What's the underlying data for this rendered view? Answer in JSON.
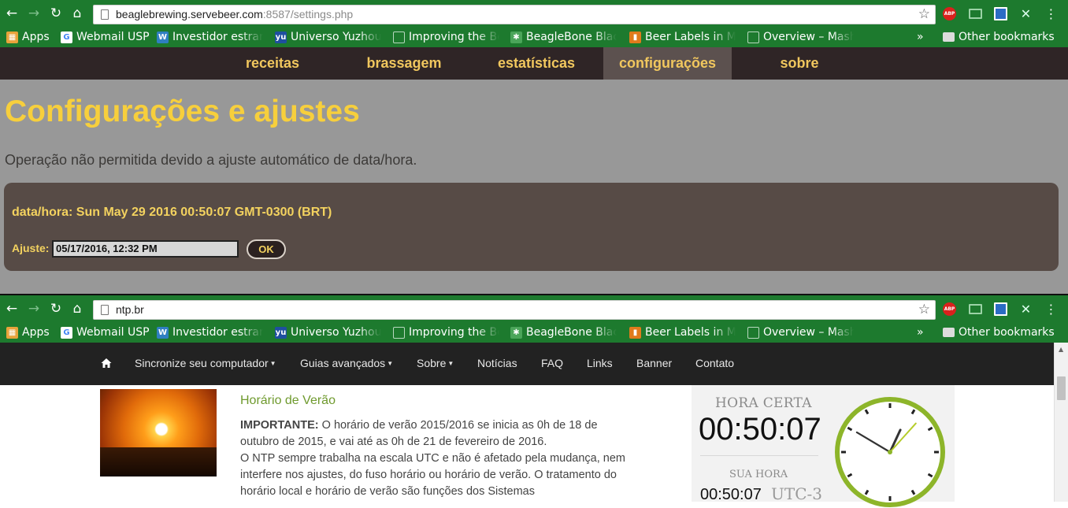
{
  "browser_top": {
    "url_host": "beaglebrewing.servebeer.com",
    "url_rest": ":8587/settings.php",
    "nav": {
      "back": "←",
      "forward": "→",
      "reload": "↻",
      "home": "⌂",
      "star": "☆"
    },
    "extensions": {
      "abp": "ABP",
      "x": "✕",
      "menu": "⋮"
    }
  },
  "browser_bottom": {
    "url_host": "ntp.br",
    "url_rest": "",
    "nav": {
      "back": "←",
      "forward": "→",
      "reload": "↻",
      "home": "⌂",
      "star": "☆"
    },
    "extensions": {
      "abp": "ABP",
      "x": "✕",
      "menu": "⋮"
    }
  },
  "bookmarks": {
    "items": [
      {
        "label": "Apps",
        "icon": "apps-grid-icon",
        "color": "#e8a33b"
      },
      {
        "label": "Webmail USP",
        "icon": "google-icon",
        "color": "#ffffff"
      },
      {
        "label": "Investidor estran",
        "icon": "wordpress-icon",
        "color": "#2f7fc1"
      },
      {
        "label": "Universo Yuzhou",
        "icon": "yu-icon",
        "color": "#1f4fa0"
      },
      {
        "label": "Improving the Be",
        "icon": "page-icon",
        "color": "#1d7a2e"
      },
      {
        "label": "BeagleBone Blac",
        "icon": "beaglebone-icon",
        "color": "#4ba55a"
      },
      {
        "label": "Beer Labels in Mo",
        "icon": "beer-icon",
        "color": "#e07b1c"
      },
      {
        "label": "Overview – Mash",
        "icon": "page-icon",
        "color": "#1d7a2e"
      }
    ],
    "overflow": "»",
    "other": "Other bookmarks"
  },
  "beagle": {
    "nav": [
      "receitas",
      "brassagem",
      "estatísticas",
      "configurações",
      "sobre"
    ],
    "active_nav": "configurações",
    "title": "Configurações e ajustes",
    "message": "Operação não permitida devido a ajuste automático de data/hora.",
    "datetime": "data/hora: Sun May 29 2016 00:50:07 GMT-0300 (BRT)",
    "adjust_label": "Ajuste:",
    "adjust_value": "05/17/2016, 12:32  PM",
    "ok_label": "OK",
    "colors": {
      "nav_bg": "#2f2526",
      "accent": "#f7cf3c",
      "panel_bg": "#574b46",
      "page_bg": "#989898"
    }
  },
  "ntp": {
    "nav": [
      {
        "label": "Sincronize seu computador",
        "dropdown": true
      },
      {
        "label": "Guias avançados",
        "dropdown": true
      },
      {
        "label": "Sobre",
        "dropdown": true
      },
      {
        "label": "Notícias",
        "dropdown": false
      },
      {
        "label": "FAQ",
        "dropdown": false
      },
      {
        "label": "Links",
        "dropdown": false
      },
      {
        "label": "Banner",
        "dropdown": false
      },
      {
        "label": "Contato",
        "dropdown": false
      }
    ],
    "article": {
      "title": "Horário de Verão",
      "important_label": "IMPORTANTE:",
      "paragraph1": " O horário de verão 2015/2016 se inicia as 0h de 18 de outubro de 2015, e vai até as 0h de 21 de fevereiro de 2016.",
      "paragraph2": "O NTP sempre trabalha na escala UTC e não é afetado pela mudança, nem interfere nos ajustes, do fuso horário ou horário de verão. O tratamento do horário local e horário de verão são funções dos Sistemas"
    },
    "clock": {
      "label": "HORA CERTA",
      "time": "00:50:07",
      "local_label": "SUA HORA",
      "local_time": "00:50:07",
      "utc": "UTC-3",
      "hands": {
        "hour": 0,
        "minute": 50,
        "second": 7
      },
      "ring_color": "#8db52a"
    }
  }
}
